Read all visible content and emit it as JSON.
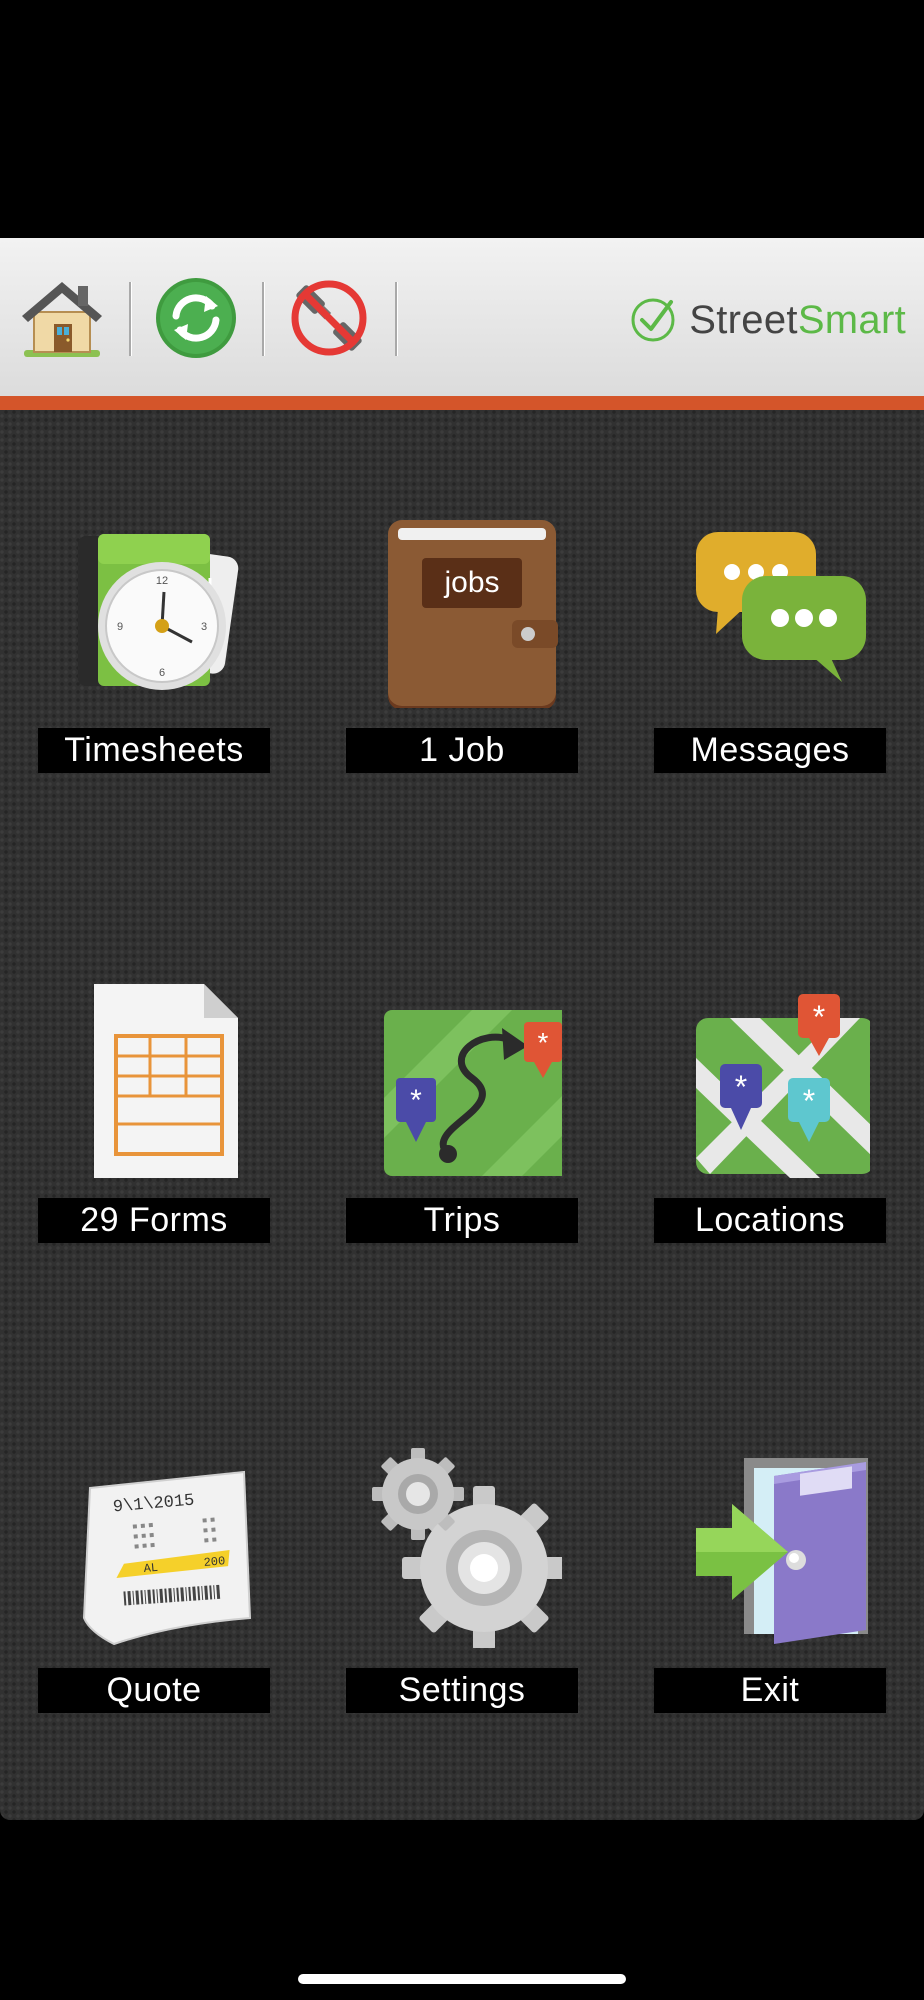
{
  "app": {
    "name": "StreetSmart"
  },
  "toolbar": {
    "buttons": [
      {
        "name": "home",
        "icon": "house-icon"
      },
      {
        "name": "sync",
        "icon": "refresh-icon"
      },
      {
        "name": "connection",
        "icon": "disconnected-plug-icon"
      }
    ],
    "brand": {
      "text_plain": "Street",
      "text_accent": "Smart",
      "icon": "checkmark-circle-icon",
      "accent_color": "#5cb947"
    },
    "accent_bar_color": "#d4552a"
  },
  "tiles": [
    {
      "label": "Timesheets",
      "icon": "timesheet-clock-icon"
    },
    {
      "label": "1 Job",
      "icon": "jobs-wallet-icon",
      "icon_text": "jobs"
    },
    {
      "label": "Messages",
      "icon": "chat-bubbles-icon"
    },
    {
      "label": "29 Forms",
      "icon": "form-document-icon"
    },
    {
      "label": "Trips",
      "icon": "trip-route-map-icon"
    },
    {
      "label": "Locations",
      "icon": "location-pins-map-icon"
    },
    {
      "label": "Quote",
      "icon": "receipt-icon",
      "icon_text": {
        "date": "9\\1\\2015",
        "tag_left": "AL",
        "tag_right": "200"
      }
    },
    {
      "label": "Settings",
      "icon": "gears-icon"
    },
    {
      "label": "Exit",
      "icon": "exit-door-icon"
    }
  ]
}
